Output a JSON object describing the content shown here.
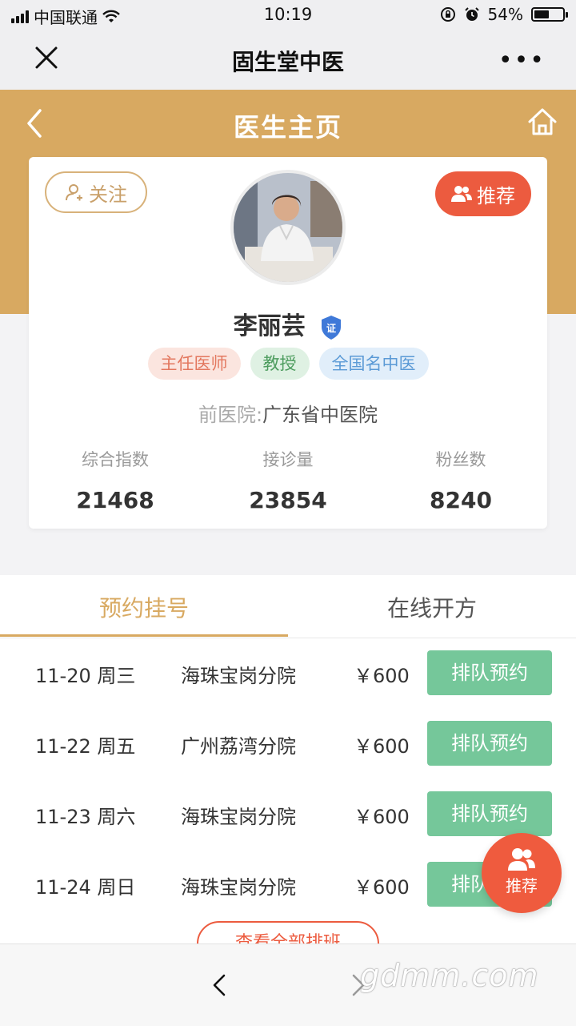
{
  "status": {
    "carrier": "中国联通",
    "time": "10:19",
    "battery": "54%",
    "battery_level": 0.54
  },
  "wechat_nav": {
    "title": "固生堂中医"
  },
  "header": {
    "title": "医生主页"
  },
  "doctor": {
    "follow_label": "关注",
    "recommend_label": "推荐",
    "name": "李丽芸",
    "verify_badge": "证",
    "tags": [
      "主任医师",
      "教授",
      "全国名中医"
    ],
    "hospital_label": "前医院:",
    "hospital": "广东省中医院",
    "stats": [
      {
        "label": "综合指数",
        "value": "21468"
      },
      {
        "label": "接诊量",
        "value": "23854"
      },
      {
        "label": "粉丝数",
        "value": "8240"
      }
    ]
  },
  "tabs": [
    {
      "label": "预约挂号",
      "active": true
    },
    {
      "label": "在线开方",
      "active": false
    }
  ],
  "schedule": [
    {
      "date": "11-20 周三",
      "branch": "海珠宝岗分院",
      "price": "￥600",
      "action": "排队预约"
    },
    {
      "date": "11-22 周五",
      "branch": "广州荔湾分院",
      "price": "￥600",
      "action": "排队预约"
    },
    {
      "date": "11-23 周六",
      "branch": "海珠宝岗分院",
      "price": "￥600",
      "action": "排队预约"
    },
    {
      "date": "11-24 周日",
      "branch": "海珠宝岗分院",
      "price": "￥600",
      "action": "排队预约"
    }
  ],
  "view_all_label": "查看全部排班",
  "fab_label": "推荐",
  "watermark": "gdmm.com",
  "colors": {
    "gold": "#d8a961",
    "red": "#ec5b3f",
    "green": "#75c79a"
  }
}
